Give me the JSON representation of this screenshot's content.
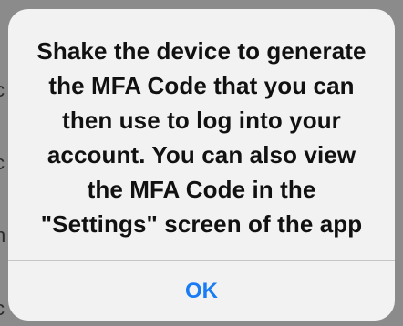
{
  "alert": {
    "message_lines": [
      "Shake the device to generate",
      "the MFA Code that you can",
      "then use to log into your",
      "account. You can also view",
      "the MFA Code in the",
      "\"Settings\" screen of the app"
    ],
    "ok_label": "OK"
  },
  "backdrop": {
    "left_edge_glyphs": [
      "i",
      "c",
      "c",
      "n",
      "c"
    ]
  },
  "colors": {
    "dialog_background": "#f2f2f2",
    "button_text": "#1a7cf5",
    "message_text": "#111111",
    "divider": "#c6c6c8",
    "backdrop": "#8b8b8b"
  }
}
